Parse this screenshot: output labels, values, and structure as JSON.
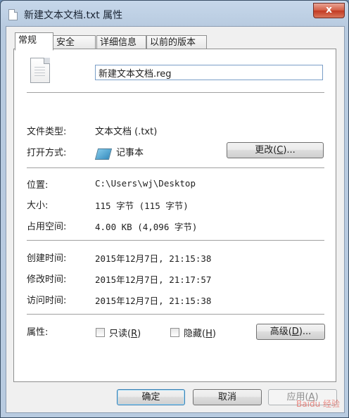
{
  "window": {
    "title": "新建文本文档.txt 属性",
    "close_symbol": "x"
  },
  "tabs": [
    {
      "label": "常规",
      "active": true
    },
    {
      "label": "安全",
      "active": false
    },
    {
      "label": "详细信息",
      "active": false
    },
    {
      "label": "以前的版本",
      "active": false
    }
  ],
  "file": {
    "icon": "text-file-icon",
    "name_value": "新建文本文档.reg"
  },
  "type_section": {
    "file_type_label": "文件类型:",
    "file_type_value": "文本文档 (.txt)",
    "opens_with_label": "打开方式:",
    "opens_with_icon": "notepad-icon",
    "opens_with_value": "记事本",
    "change_button": "更改(",
    "change_key": "C",
    "change_suffix": ")..."
  },
  "location_section": {
    "location_label": "位置:",
    "location_value": "C:\\Users\\wj\\Desktop",
    "size_label": "大小:",
    "size_value": "115 字节 (115 字节)",
    "size_on_disk_label": "占用空间:",
    "size_on_disk_value": "4.00 KB (4,096 字节)"
  },
  "time_section": {
    "created_label": "创建时间:",
    "created_value": "2015年12月7日, 21:15:38",
    "modified_label": "修改时间:",
    "modified_value": "2015年12月7日, 21:17:57",
    "accessed_label": "访问时间:",
    "accessed_value": "2015年12月7日, 21:15:38"
  },
  "attributes": {
    "label": "属性:",
    "readonly_label": "只读(",
    "readonly_key": "R",
    "readonly_suffix": ")",
    "readonly_checked": false,
    "hidden_label": "隐藏(",
    "hidden_key": "H",
    "hidden_suffix": ")",
    "hidden_checked": false,
    "advanced_button": "高级(",
    "advanced_key": "D",
    "advanced_suffix": ")..."
  },
  "footer": {
    "ok": "确定",
    "cancel": "取消",
    "apply": "应用(",
    "apply_key": "A",
    "apply_suffix": ")"
  },
  "watermark": "Baidu 经验"
}
